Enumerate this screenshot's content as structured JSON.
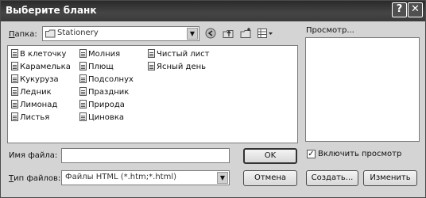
{
  "window": {
    "title": "Выберите бланк",
    "help_button": "?",
    "close_button": "✕"
  },
  "location": {
    "label_underlined": "П",
    "label_rest": "апка:",
    "value": "Stationery"
  },
  "files": [
    [
      "В клеточку",
      "Карамелька",
      "Кукуруза",
      "Ледник",
      "Лимонад",
      "Листья"
    ],
    [
      "Молния",
      "Плющ",
      "Подсолнух",
      "Праздник",
      "Природа",
      "Циновка"
    ],
    [
      "Чистый лист",
      "Ясный день"
    ]
  ],
  "preview": {
    "title": "Просмотр..."
  },
  "filename": {
    "label": "Имя файла:",
    "value": ""
  },
  "filetype": {
    "label_underlined": "Т",
    "label_rest": "ип файлов:",
    "value": "Файлы HTML (*.htm;*.html)"
  },
  "buttons": {
    "ok": "OK",
    "cancel": "Отмена",
    "create": "Создать...",
    "edit": "Изменить"
  },
  "enable_preview": {
    "label": "Включить просмотр",
    "checked": true,
    "check_glyph": "✓"
  }
}
